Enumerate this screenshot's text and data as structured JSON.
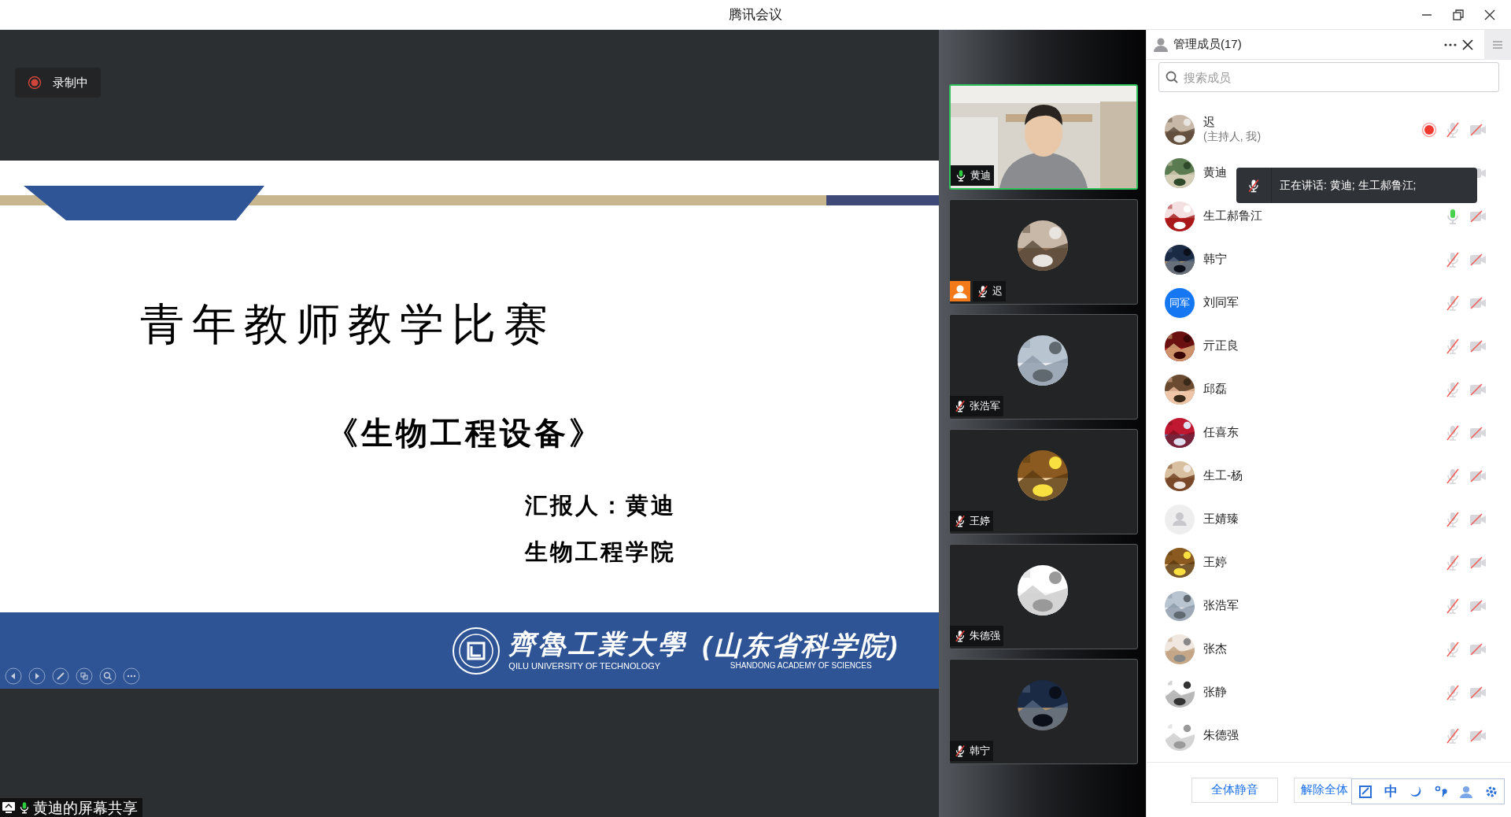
{
  "window": {
    "title": "腾讯会议"
  },
  "recording": {
    "label": "录制中",
    "on": true
  },
  "slide": {
    "title": "青年教师教学比赛",
    "subtitle": "《生物工程设备》",
    "presenter": "汇报人：黄迪",
    "department": "生物工程学院",
    "footer": {
      "school": "齊魯工業大學",
      "school_en": "QILU UNIVERSITY OF TECHNOLOGY",
      "academy": "(山东省科学院)",
      "academy_en": "SHANDONG ACADEMY OF SCIENCES"
    }
  },
  "share_label": {
    "text": "黄迪的屏幕共享",
    "mic_on": true
  },
  "video_tiles": [
    {
      "name": "黄迪",
      "mic_on": true,
      "video": true,
      "speaking": true,
      "host": false
    },
    {
      "name": "迟",
      "mic_on": false,
      "video": false,
      "speaking": false,
      "host": true
    },
    {
      "name": "张浩军",
      "mic_on": false,
      "video": false,
      "speaking": false,
      "host": false
    },
    {
      "name": "王婷",
      "mic_on": false,
      "video": false,
      "speaking": false,
      "host": false
    },
    {
      "name": "朱德强",
      "mic_on": false,
      "video": false,
      "speaking": false,
      "host": false
    },
    {
      "name": "韩宁",
      "mic_on": false,
      "video": false,
      "speaking": false,
      "host": false
    }
  ],
  "members_panel": {
    "title": "管理成员(17)",
    "search": {
      "placeholder": "搜索成员"
    },
    "members": [
      {
        "name": "迟",
        "note": "(主持人, 我)",
        "kind": "picture",
        "recording": true,
        "mic_on": false,
        "camera": false
      },
      {
        "name": "黄迪",
        "kind": "picture",
        "recording": false,
        "camera": true
      },
      {
        "name": "生工郝鲁江",
        "kind": "picture",
        "recording": false,
        "mic_on": true,
        "camera": false
      },
      {
        "name": "韩宁",
        "kind": "picture",
        "recording": false,
        "mic_on": false,
        "camera": false
      },
      {
        "name": "刘同军",
        "kind": "text",
        "avatar_text": "同军",
        "recording": false,
        "mic_on": false,
        "camera": false
      },
      {
        "name": "亓正良",
        "kind": "picture",
        "recording": false,
        "mic_on": false,
        "camera": false
      },
      {
        "name": "邱磊",
        "kind": "picture",
        "recording": false,
        "mic_on": false,
        "camera": false
      },
      {
        "name": "任喜东",
        "kind": "picture",
        "recording": false,
        "mic_on": false,
        "camera": false
      },
      {
        "name": "生工-杨",
        "kind": "picture",
        "recording": false,
        "mic_on": false,
        "camera": false
      },
      {
        "name": "王婧臻",
        "kind": "default",
        "recording": false,
        "mic_on": false,
        "camera": false
      },
      {
        "name": "王婷",
        "kind": "picture",
        "recording": false,
        "mic_on": false,
        "camera": false
      },
      {
        "name": "张浩军",
        "kind": "picture",
        "recording": false,
        "mic_on": false,
        "camera": false
      },
      {
        "name": "张杰",
        "kind": "picture",
        "recording": false,
        "mic_on": false,
        "camera": false
      },
      {
        "name": "张静",
        "kind": "picture",
        "recording": false,
        "mic_on": false,
        "camera": false
      },
      {
        "name": "朱德强",
        "kind": "picture",
        "recording": false,
        "mic_on": false,
        "camera": false
      }
    ],
    "tooltip": {
      "text": "正在讲话: 黄迪; 生工郝鲁江;"
    },
    "buttons": [
      "全体静音",
      "解除全体"
    ]
  },
  "ime_toolbar": {
    "mode": "中"
  }
}
